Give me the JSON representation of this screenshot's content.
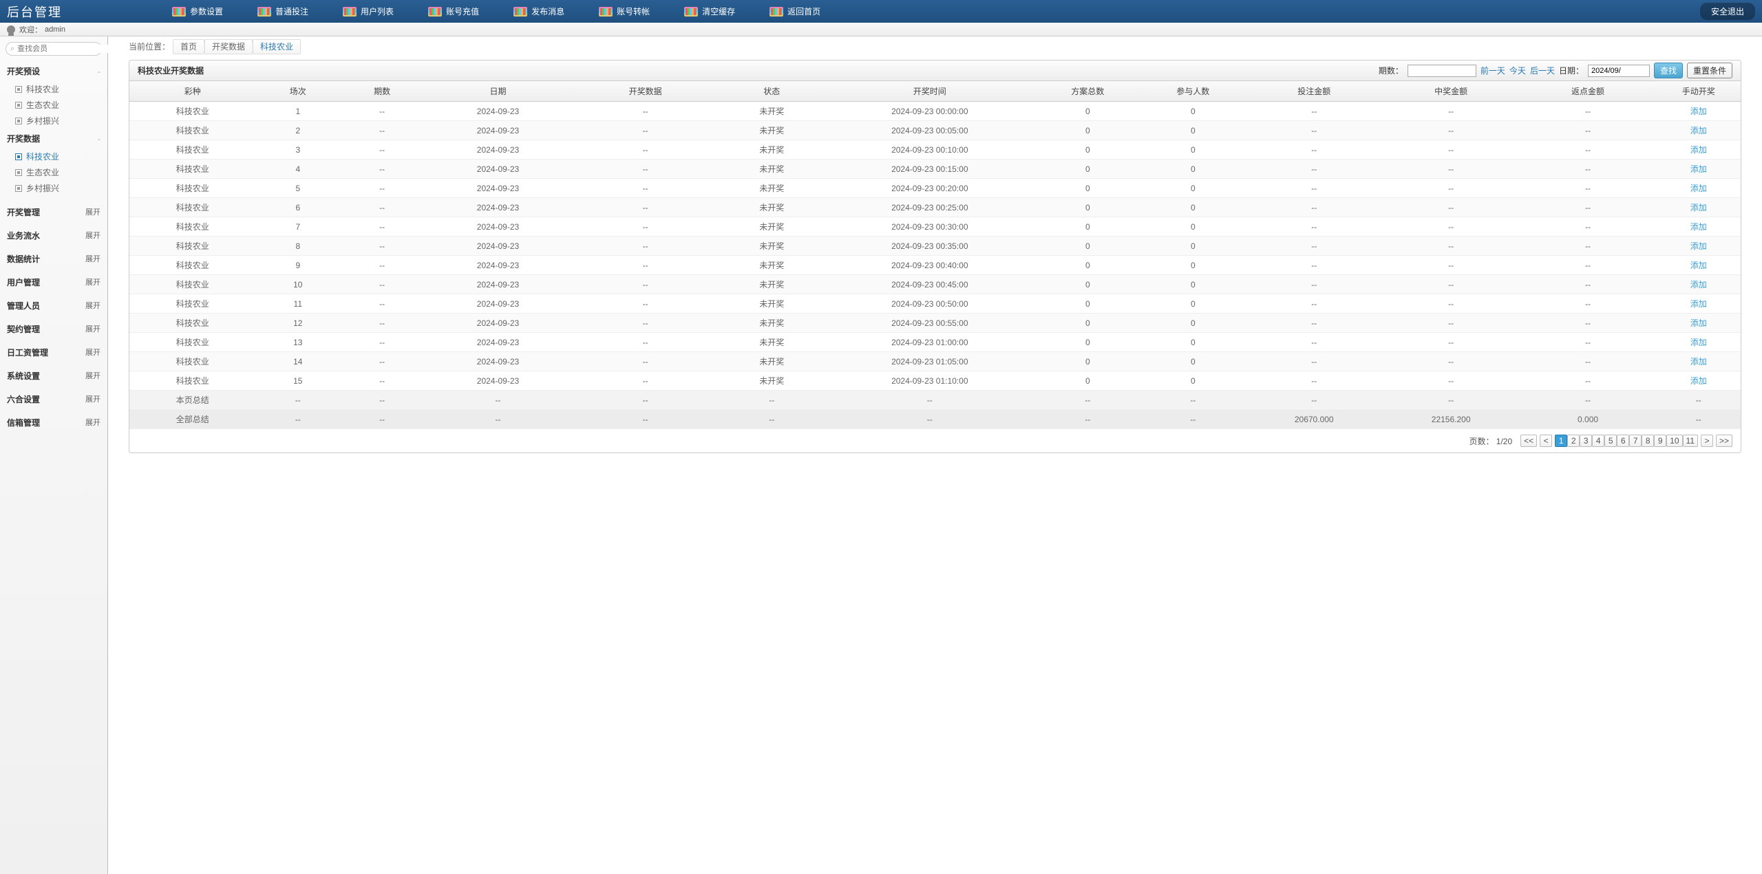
{
  "brand": "后台管理",
  "topnav": [
    {
      "label": "参数设置"
    },
    {
      "label": "普通投注"
    },
    {
      "label": "用户列表"
    },
    {
      "label": "账号充值"
    },
    {
      "label": "发布消息"
    },
    {
      "label": "账号转帐"
    },
    {
      "label": "清空缓存"
    },
    {
      "label": "返回首页"
    }
  ],
  "logout_label": "安全退出",
  "welcome_prefix": "欢迎：",
  "welcome_user": "admin",
  "search_placeholder": "查找会员",
  "sidebar": {
    "group1": {
      "title": "开奖预设",
      "items": [
        "科技农业",
        "生态农业",
        "乡村振兴"
      ]
    },
    "group2": {
      "title": "开奖数据",
      "items": [
        "科技农业",
        "生态农业",
        "乡村振兴"
      ],
      "active_index": 0
    },
    "collapsed": [
      {
        "title": "开奖管理",
        "action": "展开"
      },
      {
        "title": "业务流水",
        "action": "展开"
      },
      {
        "title": "数据统计",
        "action": "展开"
      },
      {
        "title": "用户管理",
        "action": "展开"
      },
      {
        "title": "管理人员",
        "action": "展开"
      },
      {
        "title": "契约管理",
        "action": "展开"
      },
      {
        "title": "日工资管理",
        "action": "展开"
      },
      {
        "title": "系统设置",
        "action": "展开"
      },
      {
        "title": "六合设置",
        "action": "展开"
      },
      {
        "title": "信箱管理",
        "action": "展开"
      }
    ]
  },
  "breadcrumb": {
    "prefix": "当前位置：",
    "items": [
      "首页",
      "开奖数据",
      "科技农业"
    ]
  },
  "panel_title": "科技农业开奖数据",
  "controls": {
    "period_label": "期数：",
    "prev_day": "前一天",
    "today": "今天",
    "next_day": "后一天",
    "date_label": "日期：",
    "date_value": "2024/09/",
    "search_btn": "查找",
    "reset_btn": "重置条件"
  },
  "columns": [
    "彩种",
    "场次",
    "期数",
    "日期",
    "开奖数据",
    "状态",
    "开奖时间",
    "方案总数",
    "参与人数",
    "投注金额",
    "中奖金额",
    "返点金额",
    "手动开奖"
  ],
  "rows": [
    {
      "lottery": "科技农业",
      "round": "1",
      "period": "--",
      "date": "2024-09-23",
      "data": "--",
      "status": "未开奖",
      "time": "2024-09-23 00:00:00",
      "plans": "0",
      "users": "0",
      "bet": "--",
      "win": "--",
      "rebate": "--",
      "action": "添加"
    },
    {
      "lottery": "科技农业",
      "round": "2",
      "period": "--",
      "date": "2024-09-23",
      "data": "--",
      "status": "未开奖",
      "time": "2024-09-23 00:05:00",
      "plans": "0",
      "users": "0",
      "bet": "--",
      "win": "--",
      "rebate": "--",
      "action": "添加"
    },
    {
      "lottery": "科技农业",
      "round": "3",
      "period": "--",
      "date": "2024-09-23",
      "data": "--",
      "status": "未开奖",
      "time": "2024-09-23 00:10:00",
      "plans": "0",
      "users": "0",
      "bet": "--",
      "win": "--",
      "rebate": "--",
      "action": "添加"
    },
    {
      "lottery": "科技农业",
      "round": "4",
      "period": "--",
      "date": "2024-09-23",
      "data": "--",
      "status": "未开奖",
      "time": "2024-09-23 00:15:00",
      "plans": "0",
      "users": "0",
      "bet": "--",
      "win": "--",
      "rebate": "--",
      "action": "添加"
    },
    {
      "lottery": "科技农业",
      "round": "5",
      "period": "--",
      "date": "2024-09-23",
      "data": "--",
      "status": "未开奖",
      "time": "2024-09-23 00:20:00",
      "plans": "0",
      "users": "0",
      "bet": "--",
      "win": "--",
      "rebate": "--",
      "action": "添加"
    },
    {
      "lottery": "科技农业",
      "round": "6",
      "period": "--",
      "date": "2024-09-23",
      "data": "--",
      "status": "未开奖",
      "time": "2024-09-23 00:25:00",
      "plans": "0",
      "users": "0",
      "bet": "--",
      "win": "--",
      "rebate": "--",
      "action": "添加"
    },
    {
      "lottery": "科技农业",
      "round": "7",
      "period": "--",
      "date": "2024-09-23",
      "data": "--",
      "status": "未开奖",
      "time": "2024-09-23 00:30:00",
      "plans": "0",
      "users": "0",
      "bet": "--",
      "win": "--",
      "rebate": "--",
      "action": "添加"
    },
    {
      "lottery": "科技农业",
      "round": "8",
      "period": "--",
      "date": "2024-09-23",
      "data": "--",
      "status": "未开奖",
      "time": "2024-09-23 00:35:00",
      "plans": "0",
      "users": "0",
      "bet": "--",
      "win": "--",
      "rebate": "--",
      "action": "添加"
    },
    {
      "lottery": "科技农业",
      "round": "9",
      "period": "--",
      "date": "2024-09-23",
      "data": "--",
      "status": "未开奖",
      "time": "2024-09-23 00:40:00",
      "plans": "0",
      "users": "0",
      "bet": "--",
      "win": "--",
      "rebate": "--",
      "action": "添加"
    },
    {
      "lottery": "科技农业",
      "round": "10",
      "period": "--",
      "date": "2024-09-23",
      "data": "--",
      "status": "未开奖",
      "time": "2024-09-23 00:45:00",
      "plans": "0",
      "users": "0",
      "bet": "--",
      "win": "--",
      "rebate": "--",
      "action": "添加"
    },
    {
      "lottery": "科技农业",
      "round": "11",
      "period": "--",
      "date": "2024-09-23",
      "data": "--",
      "status": "未开奖",
      "time": "2024-09-23 00:50:00",
      "plans": "0",
      "users": "0",
      "bet": "--",
      "win": "--",
      "rebate": "--",
      "action": "添加"
    },
    {
      "lottery": "科技农业",
      "round": "12",
      "period": "--",
      "date": "2024-09-23",
      "data": "--",
      "status": "未开奖",
      "time": "2024-09-23 00:55:00",
      "plans": "0",
      "users": "0",
      "bet": "--",
      "win": "--",
      "rebate": "--",
      "action": "添加"
    },
    {
      "lottery": "科技农业",
      "round": "13",
      "period": "--",
      "date": "2024-09-23",
      "data": "--",
      "status": "未开奖",
      "time": "2024-09-23 01:00:00",
      "plans": "0",
      "users": "0",
      "bet": "--",
      "win": "--",
      "rebate": "--",
      "action": "添加"
    },
    {
      "lottery": "科技农业",
      "round": "14",
      "period": "--",
      "date": "2024-09-23",
      "data": "--",
      "status": "未开奖",
      "time": "2024-09-23 01:05:00",
      "plans": "0",
      "users": "0",
      "bet": "--",
      "win": "--",
      "rebate": "--",
      "action": "添加"
    },
    {
      "lottery": "科技农业",
      "round": "15",
      "period": "--",
      "date": "2024-09-23",
      "data": "--",
      "status": "未开奖",
      "time": "2024-09-23 01:10:00",
      "plans": "0",
      "users": "0",
      "bet": "--",
      "win": "--",
      "rebate": "--",
      "action": "添加"
    }
  ],
  "page_summary": {
    "label": "本页总结",
    "round": "--",
    "period": "--",
    "date": "--",
    "data": "--",
    "status": "--",
    "time": "--",
    "plans": "--",
    "users": "--",
    "bet": "--",
    "win": "--",
    "rebate": "--",
    "action": "--"
  },
  "grand_summary": {
    "label": "全部总结",
    "round": "--",
    "period": "--",
    "date": "--",
    "data": "--",
    "status": "--",
    "time": "--",
    "plans": "--",
    "users": "--",
    "bet": "20670.000",
    "win": "22156.200",
    "rebate": "0.000",
    "action": "--"
  },
  "pager": {
    "info": "页数： 1/20",
    "first": "<<",
    "prev": "<",
    "pages": [
      "1",
      "2",
      "3",
      "4",
      "5",
      "6",
      "7",
      "8",
      "9",
      "10",
      "11"
    ],
    "active_index": 0,
    "next": ">",
    "last": ">>"
  }
}
